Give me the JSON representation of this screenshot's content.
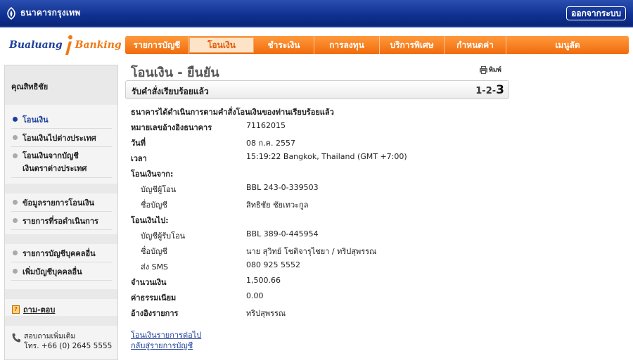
{
  "header": {
    "bank_name": "ธนาคารกรุงเทพ",
    "logout_label": "ออกจากระบบ"
  },
  "brand": {
    "part1": "Bualuang",
    "part2": "Banking"
  },
  "nav": {
    "tabs": [
      {
        "label": "รายการบัญชี"
      },
      {
        "label": "โอนเงิน"
      },
      {
        "label": "ชำระเงิน"
      },
      {
        "label": "การลงทุน"
      },
      {
        "label": "บริการพิเศษ"
      },
      {
        "label": "กำหนดค่า"
      },
      {
        "label": "เมนูลัด"
      }
    ]
  },
  "sidebar": {
    "heading": "คุณสิทธิชัย",
    "items": [
      {
        "label": "โอนเงิน"
      },
      {
        "label": "โอนเงินไปต่างประเทศ"
      },
      {
        "label": "โอนเงินจากบัญชี"
      },
      {
        "label": "เงินตราต่างประเทศ"
      },
      {
        "label": "ข้อมูลรายการโอนเงิน"
      },
      {
        "label": "รายการที่รอดำเนินการ"
      },
      {
        "label": "รายการบัญชีบุคคลอื่น"
      },
      {
        "label": "เพิ่มบัญชีบุคคลอื่น"
      }
    ],
    "qa_label": "ถาม-ตอบ",
    "contact_line1": "สอบถามเพิ่มเติม",
    "contact_line2": "โทร. +66 (0) 2645 5555"
  },
  "main": {
    "title": "โอนเงิน - ยืนยัน",
    "print_label": "พิมพ์",
    "status_text": "รับคำสั่งเรียบร้อยแล้ว",
    "steps_prefix": "1-2-",
    "steps_current": "3",
    "confirm_message": "ธนาคารได้ดำเนินการตามคำสั่งโอนเงินของท่านเรียบร้อยแล้ว",
    "fields": {
      "ref_label": "หมายเลขอ้างอิงธนาคาร",
      "ref_value": "71162015",
      "date_label": "วันที่",
      "date_value": "08 ก.ค. 2557",
      "time_label": "เวลา",
      "time_value": "15:19:22 Bangkok, Thailand (GMT +7:00)",
      "from_heading": "โอนเงินจาก:",
      "from_account_label": "บัญชีผู้โอน",
      "from_account_value": "BBL 243-0-339503",
      "from_name_label": "ชื่อบัญชี",
      "from_name_value": "สิทธิชัย ชัยเทวะกูล",
      "to_heading": "โอนเงินไป:",
      "to_account_label": "บัญชีผู้รับโอน",
      "to_account_value": "BBL 389-0-445954",
      "to_name_label": "ชื่อบัญชี",
      "to_name_value": "นาย สุวิทย์ โชติจารุไชยา / ทริปสุพรรณ",
      "sms_label": "ส่ง SMS",
      "sms_value": "080 925 5552",
      "amount_label": "จำนวนเงิน",
      "amount_value": "1,500.66",
      "fee_label": "ค่าธรรมเนียม",
      "fee_value": "0.00",
      "memo_label": "อ้างอิงรายการ",
      "memo_value": "ทริปสุพรรณ"
    },
    "link_next": "โอนเงินรายการต่อไป",
    "link_back": "กลับสู่รายการบัญชี"
  },
  "colors": {
    "header_blue": "#0f2f8f",
    "nav_orange": "#f06b0c",
    "link_blue": "#1c3f9a"
  }
}
